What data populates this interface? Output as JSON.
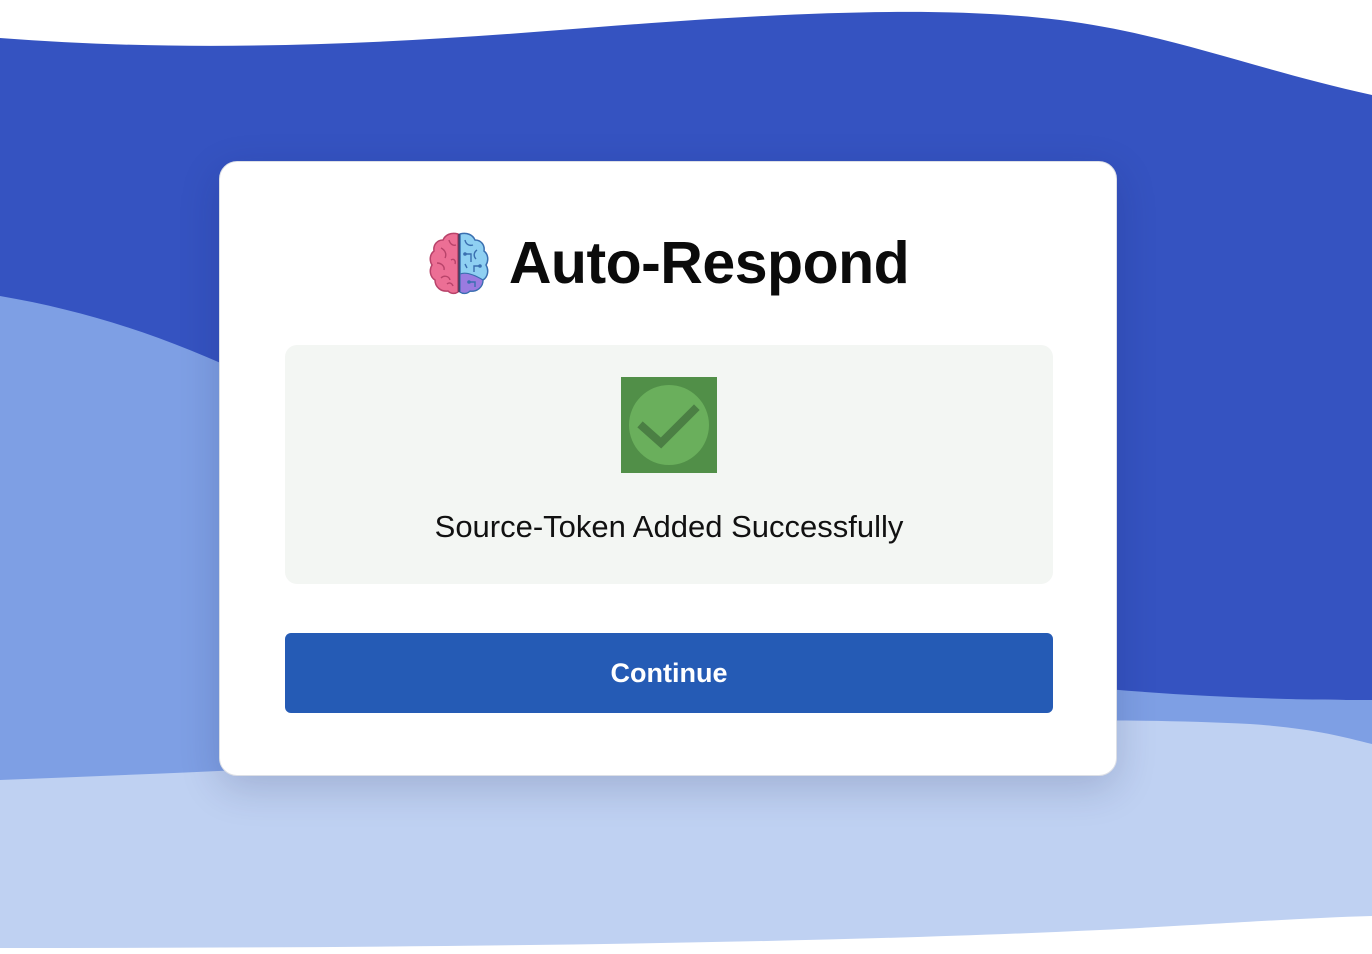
{
  "app": {
    "title": "Auto-Respond",
    "logo_icon": "brain-icon"
  },
  "status": {
    "icon": "check-circle-icon",
    "message": "Source-Token Added Successfully"
  },
  "actions": {
    "continue_label": "Continue"
  },
  "colors": {
    "wave_dark": "#3553c1",
    "wave_mid": "#7e9fe4",
    "wave_light": "#bfd1f2",
    "button": "#255bb5",
    "success_tile": "#518f48",
    "success_circle": "#6aaf5c",
    "panel": "#f3f6f3"
  }
}
